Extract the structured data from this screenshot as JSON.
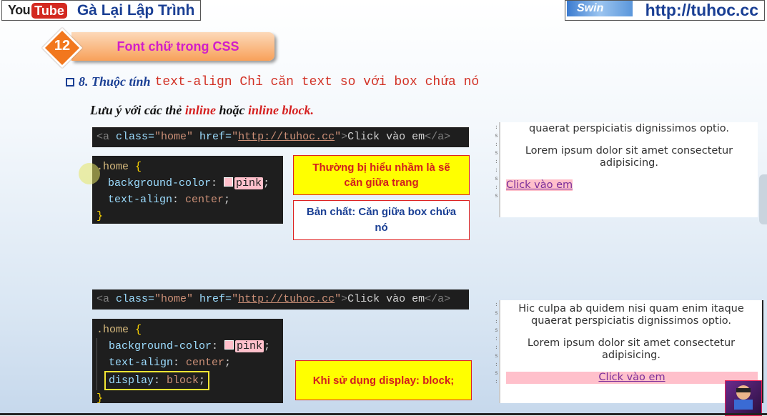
{
  "header": {
    "yt_you": "You",
    "yt_tube": "Tube",
    "channel_name": "Gà Lại Lập Trình",
    "site_logo": "Swin",
    "site_url": "http://tuhoc.cc"
  },
  "lesson": {
    "number": "12",
    "title": "Font chữ trong CSS"
  },
  "heading": {
    "italic": "8. Thuộc tính",
    "code": "text-align Chỉ căn text so với box chứa nó"
  },
  "note": {
    "part1": "Lưu ý với các thẻ ",
    "inline": "inline",
    "part2": " hoặc ",
    "inline_block": "inline block."
  },
  "example1": {
    "html": {
      "open_tag": "<a",
      "class_attr": " class=",
      "class_val": "\"home\"",
      "href_attr": " href=",
      "q_open": "\"",
      "url": "http://tuhoc.cc",
      "q_close": "\"",
      "gt": ">",
      "text": "Click vào em",
      "close_tag": "</a>"
    },
    "css": {
      "selector": ".home",
      "brace_open": " {",
      "prop1": "background-color",
      "val1": "pink",
      "prop2": "text-align",
      "val2": "center",
      "brace_close": "}"
    },
    "callout_misconception": "Thường bị hiểu nhầm là sẽ căn giữa trang",
    "callout_truth": "Bản chất: Căn giữa box chứa nó",
    "preview": {
      "line1": "quaerat perspiciatis dignissimos optio.",
      "line2": "Lorem ipsum dolor sit amet consectetur adipisicing.",
      "link": "Click vào em"
    }
  },
  "example2": {
    "html": {
      "open_tag": "<a",
      "class_attr": " class=",
      "class_val": "\"home\"",
      "href_attr": " href=",
      "q_open": "\"",
      "url": "http://tuhoc.cc",
      "q_close": "\"",
      "gt": ">",
      "text": "Click vào em",
      "close_tag": "</a>"
    },
    "css": {
      "selector": ".home",
      "brace_open": " {",
      "prop1": "background-color",
      "val1": "pink",
      "prop2": "text-align",
      "val2": "center",
      "prop3": "display",
      "val3": "block",
      "brace_close": "}"
    },
    "callout": "Khi sử dụng display: block;",
    "preview": {
      "line0": "Hic culpa ab quidem nisi quam enim itaque quaerat perspiciatis dignissimos optio.",
      "line2": "Lorem ipsum dolor sit amet consectetur adipisicing.",
      "link": "Click vào em"
    }
  },
  "colors": {
    "brand_blue": "#1a3f94",
    "accent_orange": "#f2771d",
    "lesson_title": "#d11ec9",
    "highlight_red": "#d52020",
    "pink": "#ffc0cb"
  }
}
